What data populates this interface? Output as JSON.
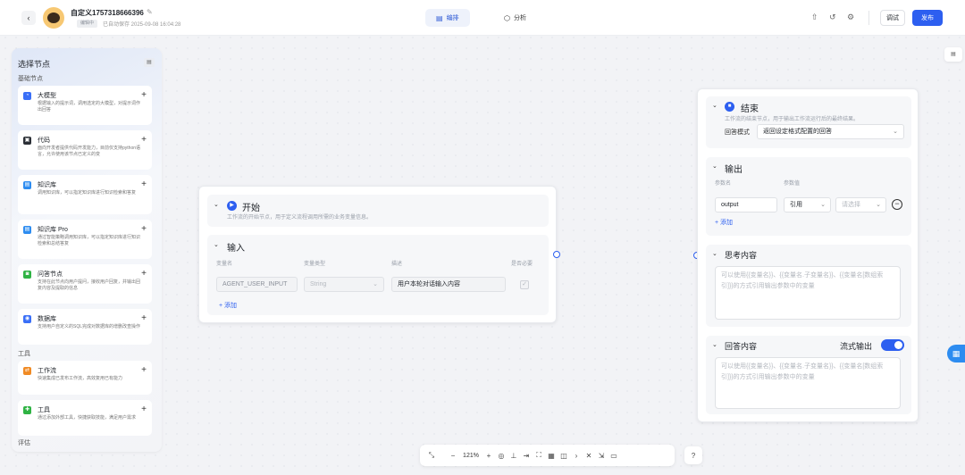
{
  "header": {
    "app_name": "自定义1757318666396",
    "status_badge": "编辑中",
    "autosave": "已自动保存 2025-09-08 16:04:28",
    "tabs": [
      {
        "label": "编排",
        "icon": "layout-icon"
      },
      {
        "label": "分析",
        "icon": "cube-icon"
      }
    ],
    "debug_label": "调试",
    "publish_label": "发布"
  },
  "sidebar": {
    "title": "选择节点",
    "section_basic": "基础节点",
    "section_tools": "工具",
    "section_more": "评估",
    "items": [
      {
        "name": "大模型",
        "desc": "根据输入的提示词，调用选定的大模型，对提示词作出回答",
        "color": "#3a6ff7",
        "glyph": "◔"
      },
      {
        "name": "代码",
        "desc": "面向开发者提供代码开发能力，目前仅支持python语言，允许使用该节点已定义的变",
        "color": "#2b2f36",
        "glyph": "▣"
      },
      {
        "name": "知识库",
        "desc": "调用知识库，可以指定知识库进行知识检索和答复",
        "color": "#2d8cf0",
        "glyph": "▤"
      },
      {
        "name": "知识库 Pro",
        "desc": "通过智能策略调用知识库，可以指定知识库进行知识检索和总结答复",
        "color": "#2d8cf0",
        "glyph": "▤"
      },
      {
        "name": "问答节点",
        "desc": "支持在此节点向用户提问，接收用户回复，并输出回复内容及提取的信息",
        "color": "#2fb344",
        "glyph": "◙"
      },
      {
        "name": "数据库",
        "desc": "支持用户自定义的SQL完成对数据库的增删改查操作",
        "color": "#3a6ff7",
        "glyph": "◉"
      },
      {
        "name": "工作流",
        "desc": "快速集成已发布工作流，高效复用已有能力",
        "color": "#f08a24",
        "glyph": "⇄"
      },
      {
        "name": "工具",
        "desc": "通过添加外部工具，快捷获取技能，满足用户需求",
        "color": "#2fb344",
        "glyph": "✚"
      }
    ]
  },
  "start_node": {
    "title": "开始",
    "subtitle": "工作流的开始节点，用于定义流程调用所需的业务变量信息。",
    "input_title": "输入",
    "col_name": "变量名",
    "col_type": "变量类型",
    "col_desc": "描述",
    "col_required": "是否必要",
    "var_name": "AGENT_USER_INPUT",
    "var_type": "String",
    "var_desc": "用户本轮对话输入内容",
    "add_label": "添加"
  },
  "end_node": {
    "title": "结束",
    "subtitle": "工作流的结束节点，用于输出工作流运行后的最终结果。",
    "mode_label": "回答模式",
    "mode_value": "返回设定格式配置的回答",
    "output_title": "输出",
    "col_param_name": "参数名",
    "col_param_value": "参数值",
    "param_name": "output",
    "ref_label": "引用",
    "select_placeholder": "请选择",
    "add_label": "添加",
    "think_title": "思考内容",
    "think_placeholder": "可以使用{{变量名}}、{{变量名.子变量名}}、{{变量名[数组索引]}}的方式引用输出参数中的变量",
    "answer_title": "回答内容",
    "stream_label": "流式输出",
    "answer_placeholder": "可以使用{{变量名}}、{{变量名.子变量名}}、{{变量名[数组索引]}}的方式引用输出参数中的变量"
  },
  "toolbar": {
    "zoom": "121%"
  }
}
